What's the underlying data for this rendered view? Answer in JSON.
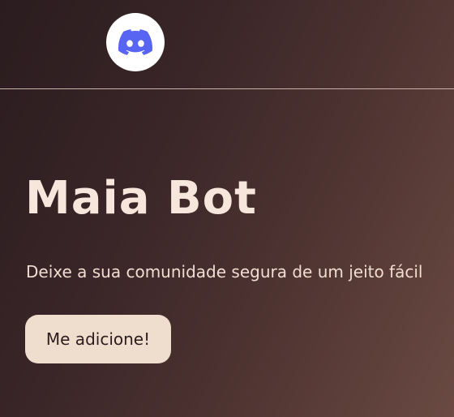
{
  "header": {
    "logo_icon": "discord-icon",
    "logo_color": "#5865F2"
  },
  "hero": {
    "title": "Maia Bot",
    "subtitle": "Deixe a sua comunidade segura de um jeito fácil",
    "cta_label": "Me adicione!"
  },
  "colors": {
    "title": "#f6e6dc",
    "button_bg": "#efddcd",
    "button_text": "#2b1c1d"
  }
}
